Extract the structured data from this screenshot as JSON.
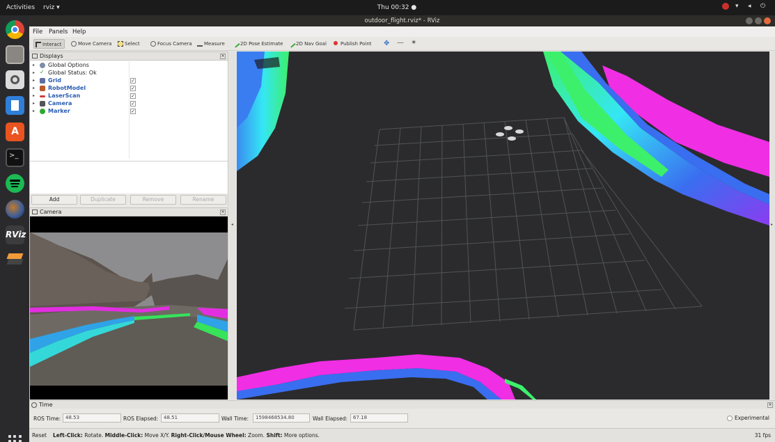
{
  "topbar": {
    "activities": "Activities",
    "app_menu": "rviz ▾",
    "clock": "Thu 00:32 ●"
  },
  "window": {
    "title": "outdoor_flight.rviz* - RViz"
  },
  "menu": {
    "file": "File",
    "panels": "Panels",
    "help": "Help"
  },
  "toolbar": {
    "tools": [
      {
        "label": "Interact",
        "icon": "cursor-icon"
      },
      {
        "label": "Move Camera",
        "icon": "move-camera-icon"
      },
      {
        "label": "Select",
        "icon": "select-icon"
      },
      {
        "label": "Focus Camera",
        "icon": "focus-camera-icon"
      },
      {
        "label": "Measure",
        "icon": "ruler-icon"
      },
      {
        "label": "2D Pose Estimate",
        "icon": "green-arrow-icon"
      },
      {
        "label": "2D Nav Goal",
        "icon": "green-arrow-icon"
      },
      {
        "label": "Publish Point",
        "icon": "pin-icon"
      }
    ]
  },
  "displays": {
    "title": "Displays",
    "items": [
      {
        "label": "Global Options",
        "checked": false,
        "blue": false,
        "icon": "gear-icon"
      },
      {
        "label": "Global Status: Ok",
        "checked": false,
        "blue": false,
        "icon": "checkmark-icon"
      },
      {
        "label": "Grid",
        "checked": true,
        "blue": true,
        "icon": "grid-icon"
      },
      {
        "label": "RobotModel",
        "checked": true,
        "blue": true,
        "icon": "robot-icon"
      },
      {
        "label": "LaserScan",
        "checked": true,
        "blue": true,
        "icon": "laser-icon"
      },
      {
        "label": "Camera",
        "checked": true,
        "blue": true,
        "icon": "camera-icon"
      },
      {
        "label": "Marker",
        "checked": true,
        "blue": true,
        "icon": "marker-icon"
      }
    ],
    "buttons": {
      "add": "Add",
      "duplicate": "Duplicate",
      "remove": "Remove",
      "rename": "Rename"
    }
  },
  "camera_panel": {
    "title": "Camera"
  },
  "time_panel": {
    "title": "Time",
    "ros_time_label": "ROS Time:",
    "ros_time": "48.53",
    "ros_elapsed_label": "ROS Elapsed:",
    "ros_elapsed": "48.51",
    "wall_time_label": "Wall Time:",
    "wall_time": "1598468534.80",
    "wall_elapsed_label": "Wall Elapsed:",
    "wall_elapsed": "67.18",
    "experimental": "Experimental"
  },
  "status": {
    "reset": "Reset",
    "help_b1": "Left-Click:",
    "help_t1": " Rotate. ",
    "help_b2": "Middle-Click:",
    "help_t2": " Move X/Y. ",
    "help_b3": "Right-Click/Mouse Wheel:",
    "help_t3": " Zoom. ",
    "help_b4": "Shift:",
    "help_t4": " More options.",
    "fps": "31 fps"
  },
  "colors": {
    "accent_blue": "#2a5db0",
    "laser_magenta": "#ff2ee0",
    "laser_cyan": "#33e5ff",
    "laser_green": "#33f06a",
    "view_background": "#2b2b2e"
  }
}
